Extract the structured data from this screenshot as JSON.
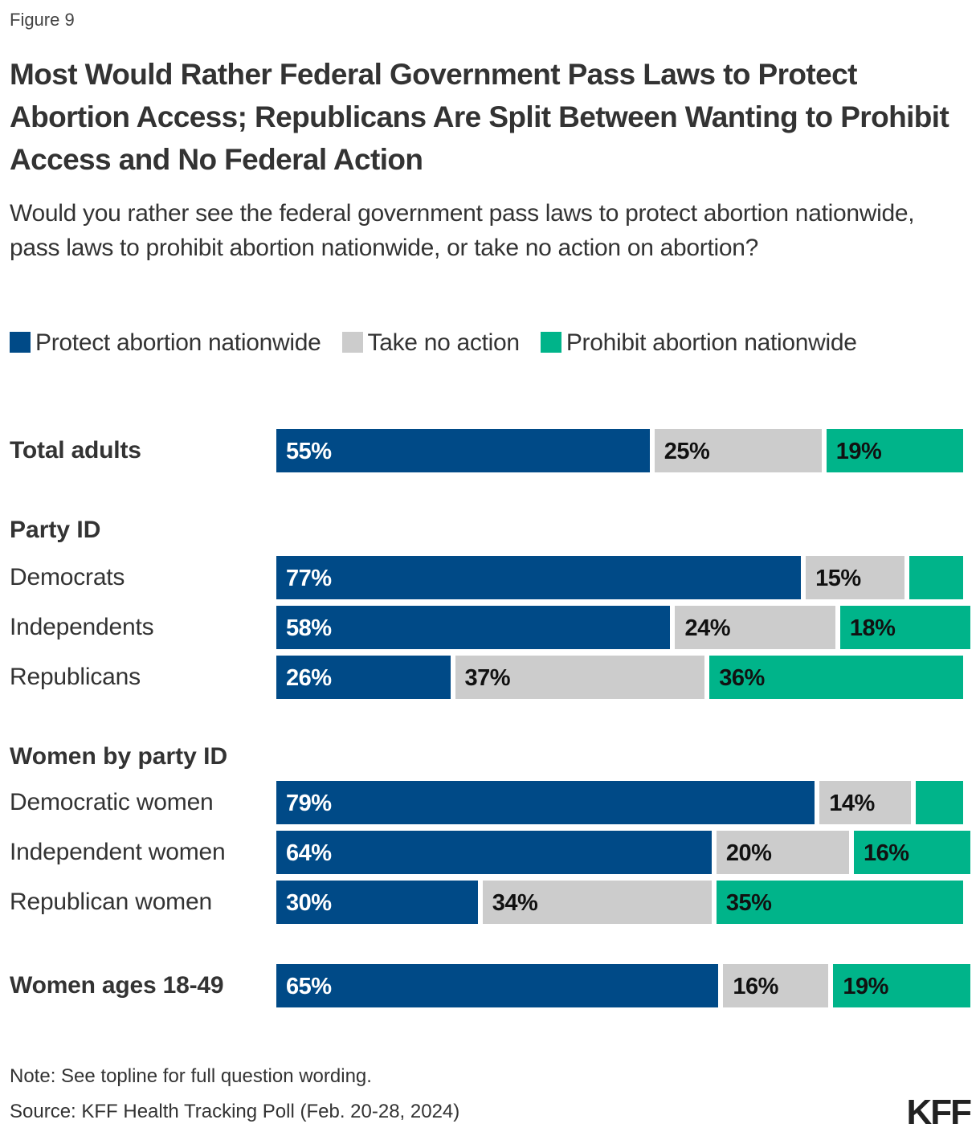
{
  "figure_label": "Figure 9",
  "chart_data": {
    "type": "bar",
    "orientation": "horizontal",
    "stacked": true,
    "title": "Most Would Rather Federal Government Pass Laws to Protect Abortion Access; Republicans Are Split Between Wanting to Prohibit Access and No Federal Action",
    "subtitle": "Would you rather see the federal government pass laws to protect abortion nationwide, pass laws to prohibit abortion nationwide, or take no action on abortion?",
    "xlabel": "",
    "ylabel": "",
    "xlim": [
      0,
      100
    ],
    "grid": false,
    "legend_position": "top-left",
    "legend": [
      {
        "name": "Protect abortion nationwide",
        "color": "#004A87"
      },
      {
        "name": "Take no action",
        "color": "#CCCCCC"
      },
      {
        "name": "Prohibit abortion nationwide",
        "color": "#00B48A"
      }
    ],
    "groups": [
      {
        "label": "",
        "rows": [
          {
            "label": "Total adults",
            "bold": true,
            "values": [
              55,
              25,
              19
            ],
            "labels": [
              "55%",
              "25%",
              "19%"
            ]
          }
        ]
      },
      {
        "label": "Party ID",
        "rows": [
          {
            "label": "Democrats",
            "bold": false,
            "values": [
              77,
              15,
              7
            ],
            "labels": [
              "77%",
              "15%",
              ""
            ]
          },
          {
            "label": "Independents",
            "bold": false,
            "values": [
              58,
              24,
              18
            ],
            "labels": [
              "58%",
              "24%",
              "18%"
            ]
          },
          {
            "label": "Republicans",
            "bold": false,
            "values": [
              26,
              37,
              36
            ],
            "labels": [
              "26%",
              "37%",
              "36%"
            ]
          }
        ]
      },
      {
        "label": "Women by party ID",
        "rows": [
          {
            "label": "Democratic women",
            "bold": false,
            "values": [
              79,
              14,
              6
            ],
            "labels": [
              "79%",
              "14%",
              ""
            ]
          },
          {
            "label": "Independent women",
            "bold": false,
            "values": [
              64,
              20,
              16
            ],
            "labels": [
              "64%",
              "20%",
              "16%"
            ]
          },
          {
            "label": "Republican women",
            "bold": false,
            "values": [
              30,
              34,
              35
            ],
            "labels": [
              "30%",
              "34%",
              "35%"
            ]
          }
        ]
      },
      {
        "label": "",
        "rows": [
          {
            "label": "Women ages 18-49",
            "bold": true,
            "values": [
              65,
              16,
              19
            ],
            "labels": [
              "65%",
              "16%",
              "19%"
            ]
          }
        ]
      }
    ],
    "label_colors": [
      "#FFFFFF",
      "#111111",
      "#111111"
    ]
  },
  "footer": {
    "note": "Note: See topline for full question wording.",
    "source": "Source: KFF Health Tracking Poll (Feb. 20-28, 2024)",
    "logo": "KFF"
  }
}
